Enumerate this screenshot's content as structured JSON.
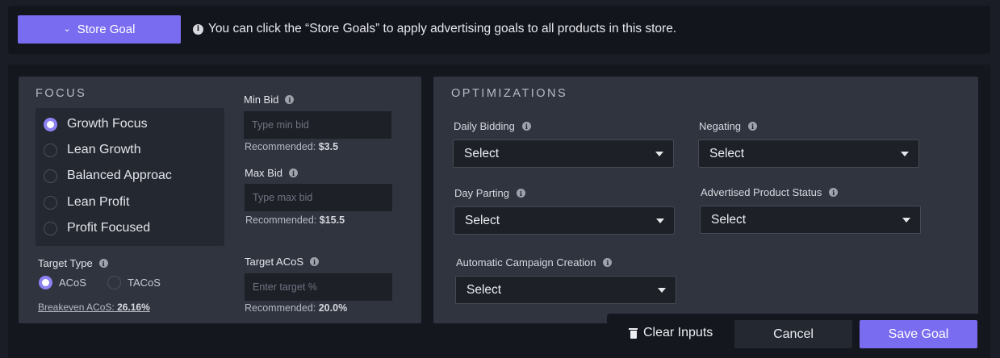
{
  "topbar": {
    "store_goal_label": "Store Goal",
    "hint": "You can click the “Store Goals” to apply advertising goals to all products in this store."
  },
  "focus": {
    "title": "FOCUS",
    "options": [
      {
        "label": "Growth Focus",
        "selected": true
      },
      {
        "label": "Lean Growth",
        "selected": false
      },
      {
        "label": "Balanced Approac",
        "selected": false
      },
      {
        "label": "Lean Profit",
        "selected": false
      },
      {
        "label": "Profit Focused",
        "selected": false
      }
    ],
    "target_type_label": "Target Type",
    "target_types": [
      {
        "label": "ACoS",
        "selected": true
      },
      {
        "label": "TACoS",
        "selected": false
      }
    ],
    "breakeven_label": "Breakeven ACoS:",
    "breakeven_value": "26.16%"
  },
  "bids": {
    "min_label": "Min Bid",
    "min_placeholder": "Type min bid",
    "min_rec_label": "Recommended:",
    "min_rec_value": "$3.5",
    "max_label": "Max Bid",
    "max_placeholder": "Type max bid",
    "max_rec_label": "Recommended:",
    "max_rec_value": "$15.5",
    "acos_label": "Target ACoS",
    "acos_placeholder": "Enter target %",
    "acos_rec_label": "Recommended:",
    "acos_rec_value": "20.0%"
  },
  "optimizations": {
    "title": "OPTIMIZATIONS",
    "daily_bidding_label": "Daily Bidding",
    "daily_bidding_value": "Select",
    "negating_label": "Negating",
    "negating_value": "Select",
    "day_parting_label": "Day Parting",
    "day_parting_value": "Select",
    "product_status_label": "Advertised Product Status",
    "product_status_value": "Select",
    "auto_campaign_label": "Automatic Campaign Creation",
    "auto_campaign_value": "Select"
  },
  "actions": {
    "clear_label": "Clear Inputs",
    "cancel_label": "Cancel",
    "save_label": "Save Goal"
  },
  "colors": {
    "accent": "#7a6cf0",
    "panel": "#30343f",
    "background": "#1a1d25"
  }
}
